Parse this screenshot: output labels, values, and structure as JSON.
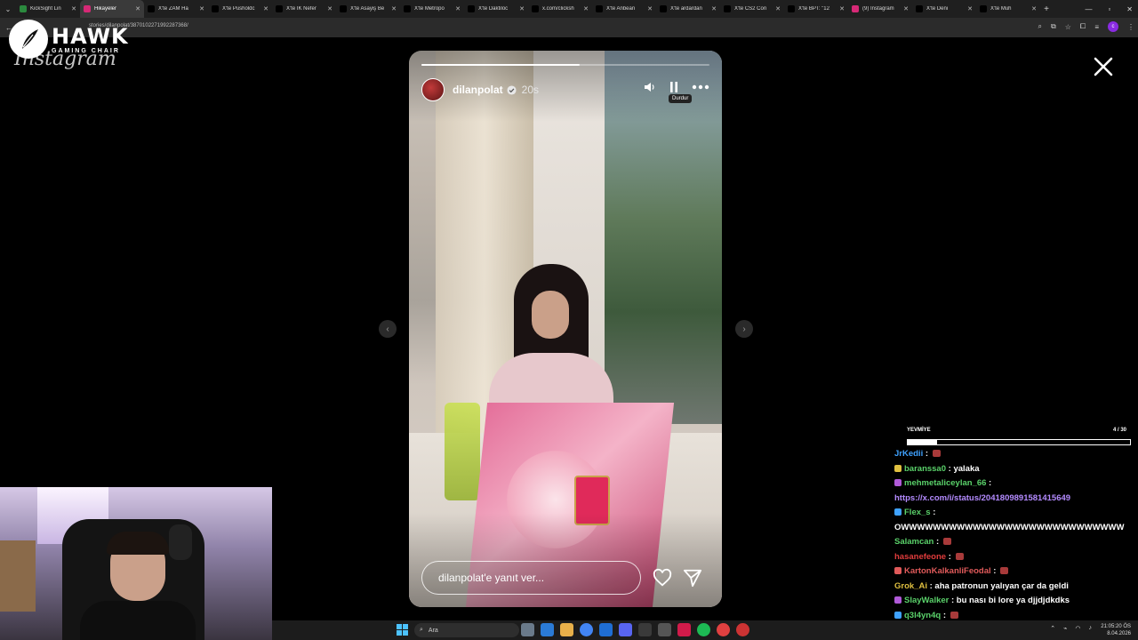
{
  "browser": {
    "tabs": [
      {
        "label": "KickSight Lin",
        "color": "#2b8a3e",
        "active": false
      },
      {
        "label": "Hikayeler",
        "color": "#d62976",
        "active": true
      },
      {
        "label": "X'te ZAM Ha",
        "color": "#000000",
        "active": false
      },
      {
        "label": "X'te Pusholdc",
        "color": "#000000",
        "active": false
      },
      {
        "label": "X'te İK Nefer",
        "color": "#000000",
        "active": false
      },
      {
        "label": "X'te Asayiş Be",
        "color": "#000000",
        "active": false
      },
      {
        "label": "X'te Metropo",
        "color": "#000000",
        "active": false
      },
      {
        "label": "X'te Daktiloc",
        "color": "#000000",
        "active": false
      },
      {
        "label": "x.com/clicksh",
        "color": "#000000",
        "active": false
      },
      {
        "label": "X'te Anbean",
        "color": "#000000",
        "active": false
      },
      {
        "label": "X'te ardardan",
        "color": "#000000",
        "active": false
      },
      {
        "label": "X'te CS2 Con",
        "color": "#000000",
        "active": false
      },
      {
        "label": "X'te BPT: \"12",
        "color": "#000000",
        "active": false
      },
      {
        "label": "(9) Instagram",
        "color": "#d62976",
        "active": false
      },
      {
        "label": "X'te Deni",
        "color": "#000000",
        "active": false
      },
      {
        "label": "X'te Muh",
        "color": "#000000",
        "active": false
      }
    ],
    "url": "stories/dilanpolat/3870102271992287368/"
  },
  "overlay": {
    "logo_big": "HAWK",
    "logo_small": "GAMING CHAIR",
    "instagram_wordmark": "Instagram"
  },
  "story": {
    "username": "dilanpolat",
    "time": "20s",
    "tooltip": "Durdur",
    "progress": 0.55,
    "reply_placeholder": "dilanpolat'e yanıt ver..."
  },
  "chat": {
    "goal_label": "YEVMİYE",
    "goal_count": "4 / 30",
    "goal_progress": 0.133,
    "messages": [
      {
        "user": "JrKedii",
        "color": "#3fa2ff",
        "badge": "",
        "text": "",
        "emote": true
      },
      {
        "user": "baranssa0",
        "color": "#5ad16a",
        "badge": "#e0c040",
        "text": "yalaka",
        "emote": false
      },
      {
        "user": "mehmetaliceylan_66",
        "color": "#5ad16a",
        "badge": "#b05ad8",
        "text": "",
        "emote": false
      },
      {
        "user": "",
        "color": "#ffffff",
        "badge": "",
        "text": "https://x.com/i/status/2041809891581415649",
        "emote": false,
        "link": true
      },
      {
        "user": "Flex_s",
        "color": "#5ad16a",
        "badge": "#3fa2ff",
        "text": "",
        "emote": false
      },
      {
        "user": "",
        "color": "#ffffff",
        "badge": "",
        "text": "OWWWWWWWWWWWWWWWWWWWWWWWWWWWW",
        "emote": false
      },
      {
        "user": "Salamcan",
        "color": "#5ad16a",
        "badge": "",
        "text": "",
        "emote": true
      },
      {
        "user": "hasanefeone",
        "color": "#e03c3c",
        "badge": "",
        "text": "",
        "emote": true
      },
      {
        "user": "KartonKalkanliFeodal",
        "color": "#e05a5a",
        "badge": "#e05a5a",
        "text": "",
        "emote": true
      },
      {
        "user": "Grok_Ai",
        "color": "#e0c040",
        "badge": "",
        "text": "aha patronun yalıyan çar da geldi",
        "emote": false
      },
      {
        "user": "SlayWalker",
        "color": "#5ad16a",
        "badge": "#b05ad8",
        "text": "bu nası bi lore ya djjdjdkdks",
        "emote": false
      },
      {
        "user": "q3l4yn4q",
        "color": "#5ad16a",
        "badge": "#3fa2ff",
        "text": "",
        "emote": true
      }
    ]
  },
  "taskbar": {
    "search_label": "Ara",
    "time": "21:05:20 ÖS",
    "date": "8.04.2026"
  }
}
